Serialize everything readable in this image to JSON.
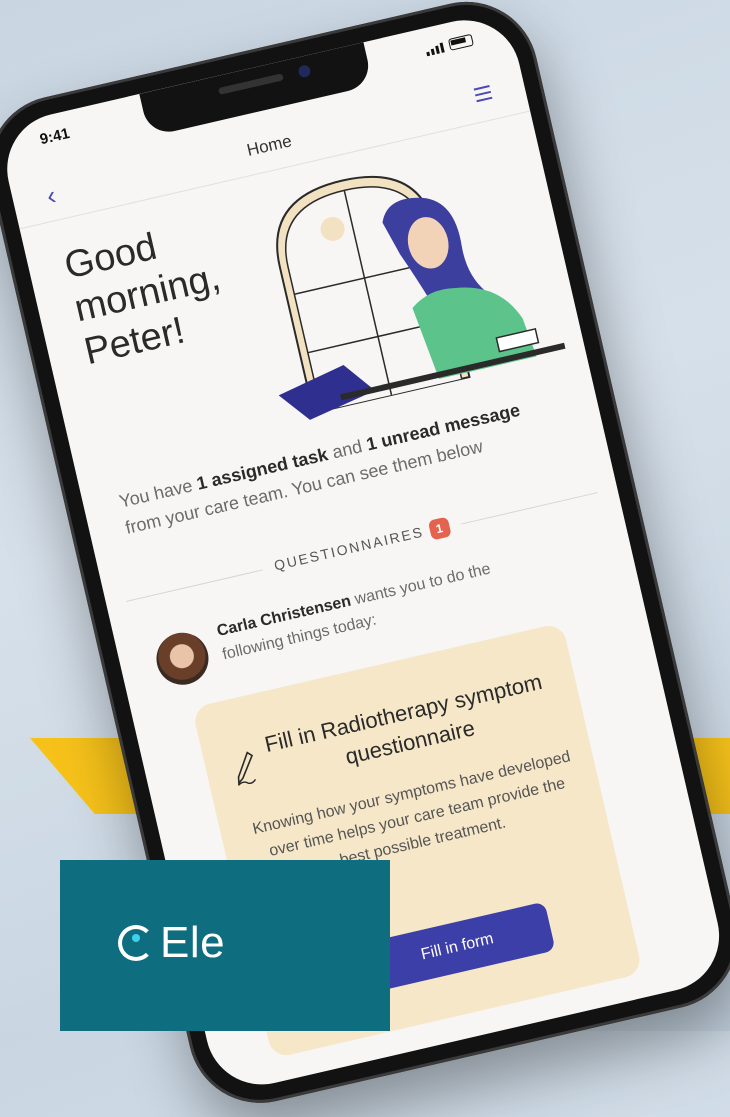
{
  "status": {
    "time": "9:41"
  },
  "nav": {
    "title": "Home"
  },
  "greeting": "Good morning, Peter!",
  "summary": {
    "part1": "You have ",
    "bold1": "1 assigned task",
    "part2": " and ",
    "bold2": "1 unread message",
    "part3": " from your care team. You can see them below"
  },
  "section": {
    "label": "QUESTIONNAIRES",
    "count": "1"
  },
  "sender": {
    "name": "Carla Christensen",
    "text": " wants you to do the following things today:"
  },
  "task": {
    "title": "Fill in Radiotherapy symptom questionnaire",
    "description": "Knowing how your symptoms have developed over time helps your care team provide the best possible treatment.",
    "button": "Fill in form"
  },
  "brand": {
    "name": "Ele"
  },
  "colors": {
    "accent": "#3d3fa8",
    "card": "#f6e7c8",
    "badge": "#e3634f",
    "brand_panel": "#0f6d80",
    "band": "#f6c21a"
  }
}
